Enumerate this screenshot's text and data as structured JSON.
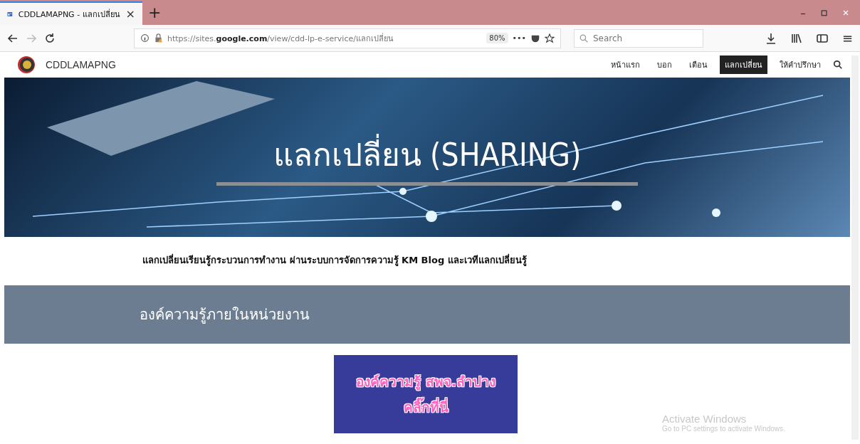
{
  "browser": {
    "tab": {
      "title": "CDDLAMAPNG - แลกเปลี่ยน",
      "close": "×",
      "selected": true
    },
    "new_tab": "+",
    "url": "https://sites.**google.com**/view/cdd-lp-e-service/แลกเปลี่ยน",
    "zoom": "80%",
    "more": "•••",
    "search": {
      "placeholder": "Search"
    },
    "menu": "≡"
  },
  "site": {
    "name": "CDDLAMAPNG",
    "nav": [
      {
        "label": "หน้าแรก",
        "selected": false
      },
      {
        "label": "บอก",
        "selected": false
      },
      {
        "label": "เตือน",
        "selected": false
      },
      {
        "label": "แลกเปลี่ยน",
        "selected": true
      },
      {
        "label": "ให้คำปรึกษา",
        "selected": false
      }
    ]
  },
  "hero": {
    "title": "แลกเปลี่ยน (SHARING)"
  },
  "intro": "แลกเปลี่ยนเรียนรู้กระบวนการทำงาน ผ่านระบบการจัดการความรู้ KM Blog และเวทีแลกเปลี่ยนรู้",
  "section": {
    "heading": "องค์ความรู้ภายในหน่วยงาน"
  },
  "link_button": {
    "lines": [
      "องค์ความรู้ สพจ.ลำปาง",
      "คลิ๊กที่นี่"
    ]
  },
  "os_notice": {
    "title": "Activate Windows",
    "text": "Go to PC settings to activate Windows."
  }
}
